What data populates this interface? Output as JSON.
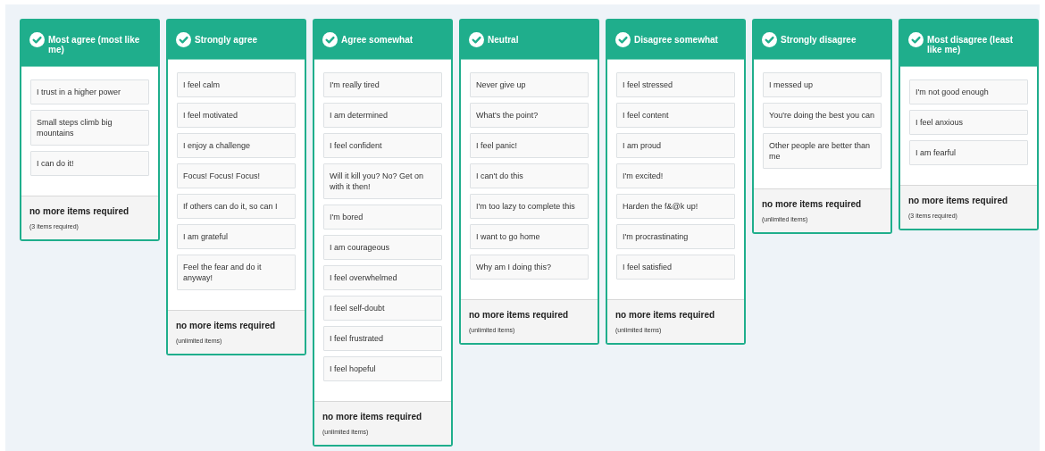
{
  "columns": [
    {
      "title": "Most agree (most like me)",
      "complete": true,
      "items": [
        "I trust in a higher power",
        "Small steps climb big mountains",
        "I can do it!"
      ],
      "status": "no more items required",
      "note": "(3 items required)"
    },
    {
      "title": "Strongly agree",
      "complete": true,
      "items": [
        "I feel calm",
        "I feel motivated",
        "I enjoy a challenge",
        "Focus! Focus! Focus!",
        "If others can do it, so can I",
        "I am grateful",
        "Feel the fear and do it anyway!"
      ],
      "status": "no more items required",
      "note": "(unlimited items)"
    },
    {
      "title": "Agree somewhat",
      "complete": true,
      "items": [
        "I'm really tired",
        "I am determined",
        "I feel confident",
        "Will it kill you? No? Get on with it then!",
        "I'm bored",
        "I am courageous",
        "I feel overwhelmed",
        "I feel self-doubt",
        "I feel frustrated",
        "I feel hopeful"
      ],
      "status": "no more items required",
      "note": "(unlimited items)"
    },
    {
      "title": "Neutral",
      "complete": true,
      "items": [
        "Never give up",
        "What's the point?",
        "I feel panic!",
        "I can't do this",
        "I'm too lazy to complete this",
        "I want to go home",
        "Why am I doing this?"
      ],
      "status": "no more items required",
      "note": "(unlimited items)"
    },
    {
      "title": "Disagree somewhat",
      "complete": true,
      "items": [
        "I feel stressed",
        "I feel content",
        "I am proud",
        "I'm excited!",
        "Harden the f&@k up!",
        "I'm procrastinating",
        "I feel satisfied"
      ],
      "status": "no more items required",
      "note": "(unlimited items)"
    },
    {
      "title": "Strongly disagree",
      "complete": true,
      "items": [
        "I messed up",
        "You're doing the best you can",
        "Other people are better than me"
      ],
      "status": "no more items required",
      "note": "(unlimited items)"
    },
    {
      "title": "Most disagree (least like me)",
      "complete": true,
      "items": [
        "I'm not good enough",
        "I feel anxious",
        "I am fearful"
      ],
      "status": "no more items required",
      "note": "(3 items required)"
    }
  ]
}
